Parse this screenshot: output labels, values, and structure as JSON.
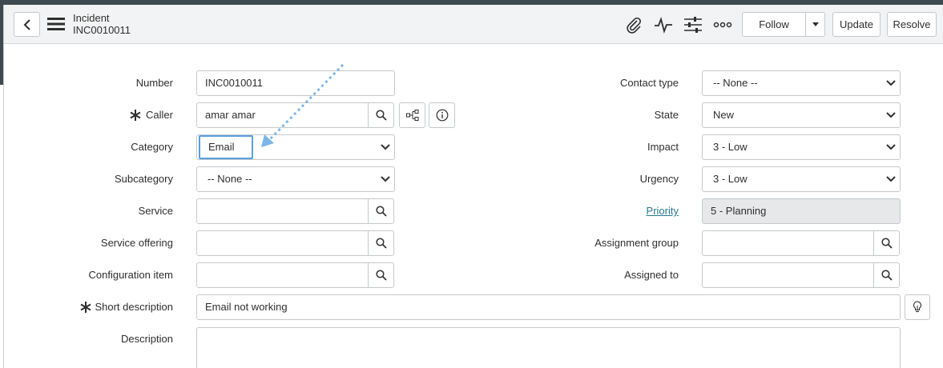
{
  "header": {
    "record_type": "Incident",
    "record_number": "INC0010011",
    "follow_label": "Follow",
    "update_label": "Update",
    "resolve_label": "Resolve",
    "icons": [
      "back-icon",
      "menu-icon",
      "paperclip-icon",
      "activity-icon",
      "settings-sliders-icon",
      "more-icon",
      "dropdown-caret-icon"
    ]
  },
  "form": {
    "left": {
      "number": {
        "label": "Number",
        "value": "INC0010011"
      },
      "caller": {
        "label": "Caller",
        "value": "amar amar",
        "required": true
      },
      "category": {
        "label": "Category",
        "value": "Email"
      },
      "subcategory": {
        "label": "Subcategory",
        "value": "-- None --"
      },
      "service": {
        "label": "Service",
        "value": ""
      },
      "service_offering": {
        "label": "Service offering",
        "value": ""
      },
      "configuration_item": {
        "label": "Configuration item",
        "value": ""
      }
    },
    "right": {
      "contact_type": {
        "label": "Contact type",
        "value": "-- None --"
      },
      "state": {
        "label": "State",
        "value": "New"
      },
      "impact": {
        "label": "Impact",
        "value": "3 - Low"
      },
      "urgency": {
        "label": "Urgency",
        "value": "3 - Low"
      },
      "priority": {
        "label": "Priority",
        "value": "5 - Planning"
      },
      "assignment_group": {
        "label": "Assignment group",
        "value": ""
      },
      "assigned_to": {
        "label": "Assigned to",
        "value": ""
      }
    },
    "short_description": {
      "label": "Short description",
      "value": "Email not working",
      "required": true
    },
    "description": {
      "label": "Description",
      "value": ""
    }
  },
  "colors": {
    "accent": "#5a9fe0",
    "link": "#267a8c",
    "header_bg": "#f2f3f4",
    "top_strip": "#3d4a4f"
  }
}
